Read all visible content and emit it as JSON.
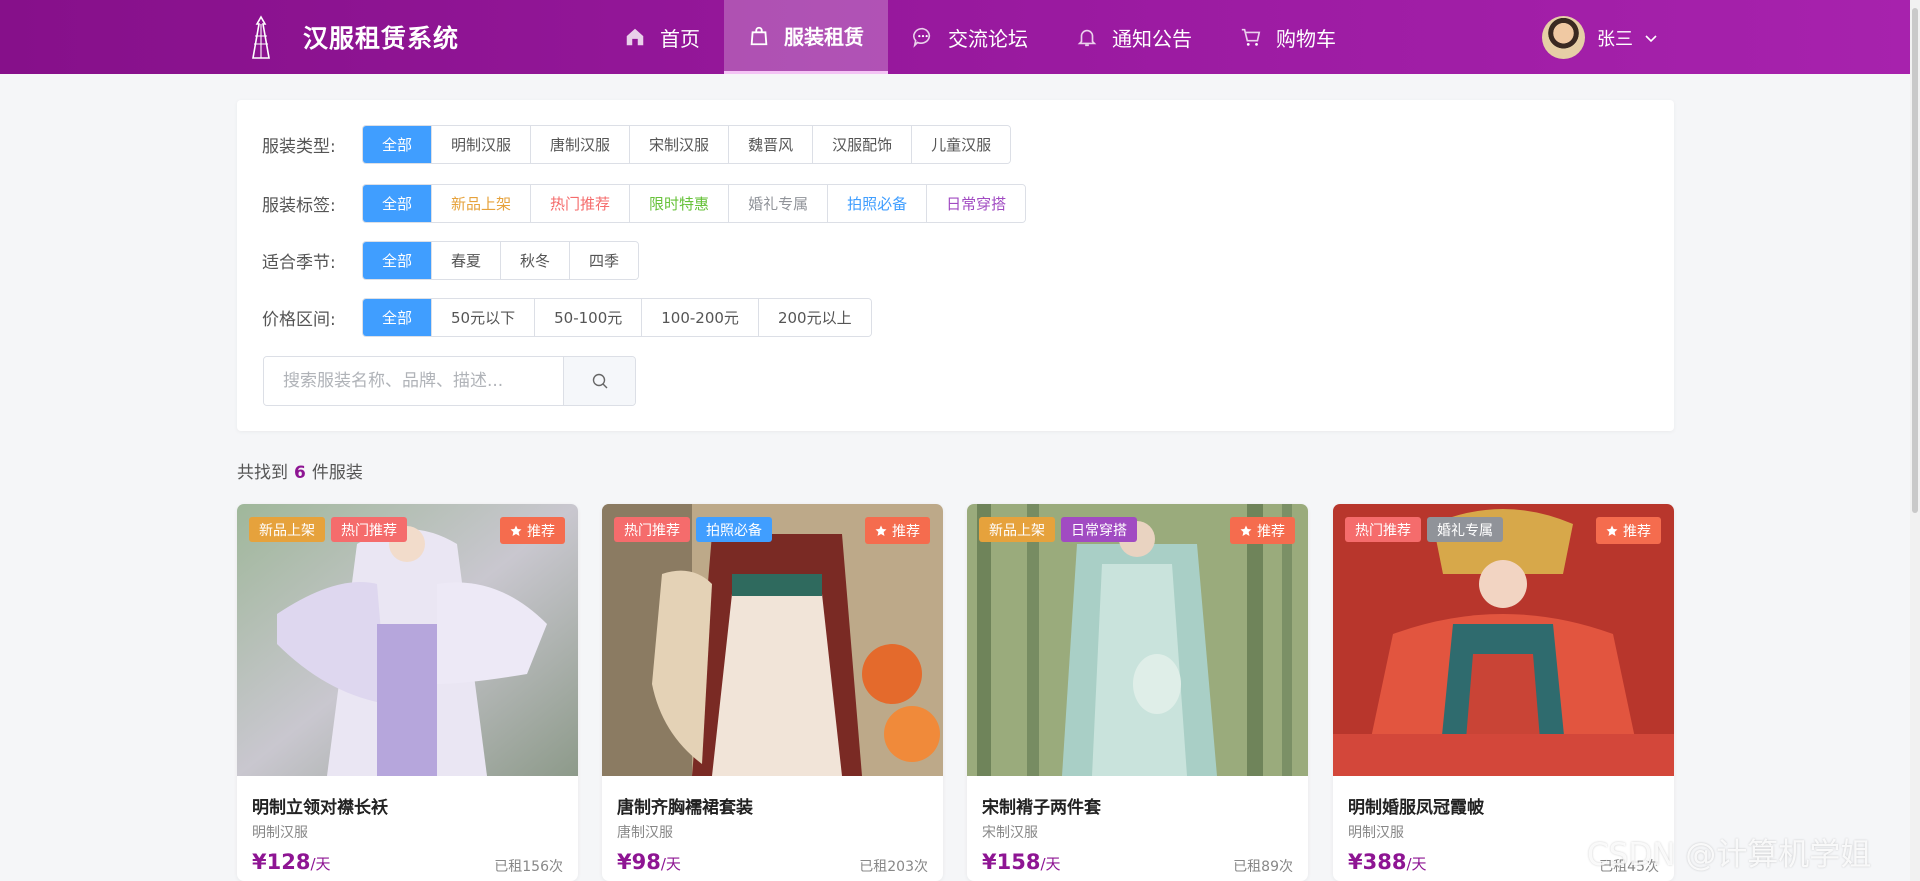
{
  "header": {
    "title": "汉服租赁系统",
    "nav": [
      {
        "label": "首页",
        "icon": "home-icon",
        "active": false
      },
      {
        "label": "服装租赁",
        "icon": "shopping-bag-icon",
        "active": true
      },
      {
        "label": "交流论坛",
        "icon": "chat-icon",
        "active": false
      },
      {
        "label": "通知公告",
        "icon": "bell-icon",
        "active": false
      },
      {
        "label": "购物车",
        "icon": "cart-icon",
        "active": false
      }
    ],
    "user_name": "张三"
  },
  "filters": {
    "type": {
      "label": "服装类型:",
      "options": [
        "全部",
        "明制汉服",
        "唐制汉服",
        "宋制汉服",
        "魏晋风",
        "汉服配饰",
        "儿童汉服"
      ],
      "selected": 0
    },
    "tag": {
      "label": "服装标签:",
      "options": [
        "全部",
        "新品上架",
        "热门推荐",
        "限时特惠",
        "婚礼专属",
        "拍照必备",
        "日常穿搭"
      ],
      "selected": 0
    },
    "season": {
      "label": "适合季节:",
      "options": [
        "全部",
        "春夏",
        "秋冬",
        "四季"
      ],
      "selected": 0
    },
    "price": {
      "label": "价格区间:",
      "options": [
        "全部",
        "50元以下",
        "50-100元",
        "100-200元",
        "200元以上"
      ],
      "selected": 0
    }
  },
  "tag_colors": {
    "新品上架": "#e6a23c",
    "热门推荐": "#f56c6c",
    "限时特惠": "#67c23a",
    "婚礼专属": "#909399",
    "拍照必备": "#409eff",
    "日常穿搭": "#a14bc2",
    "全部": "#555555"
  },
  "search": {
    "placeholder": "搜索服装名称、品牌、描述..."
  },
  "results": {
    "prefix": "共找到",
    "count": "6",
    "suffix": "件服装"
  },
  "recommend_label": "推荐",
  "products": [
    {
      "name": "明制立领对襟长袄",
      "category": "明制汉服",
      "price": "¥128",
      "unit": "/天",
      "rented": "已租156次",
      "tags": [
        "新品上架",
        "热门推荐"
      ]
    },
    {
      "name": "唐制齐胸襦裙套装",
      "category": "唐制汉服",
      "price": "¥98",
      "unit": "/天",
      "rented": "已租203次",
      "tags": [
        "热门推荐",
        "拍照必备"
      ]
    },
    {
      "name": "宋制褙子两件套",
      "category": "宋制汉服",
      "price": "¥158",
      "unit": "/天",
      "rented": "已租89次",
      "tags": [
        "新品上架",
        "日常穿搭"
      ]
    },
    {
      "name": "明制婚服凤冠霞帔",
      "category": "明制汉服",
      "price": "¥388",
      "unit": "/天",
      "rented": "已租45次",
      "tags": [
        "热门推荐",
        "婚礼专属"
      ]
    }
  ],
  "watermark": "CSDN @计算机学姐"
}
